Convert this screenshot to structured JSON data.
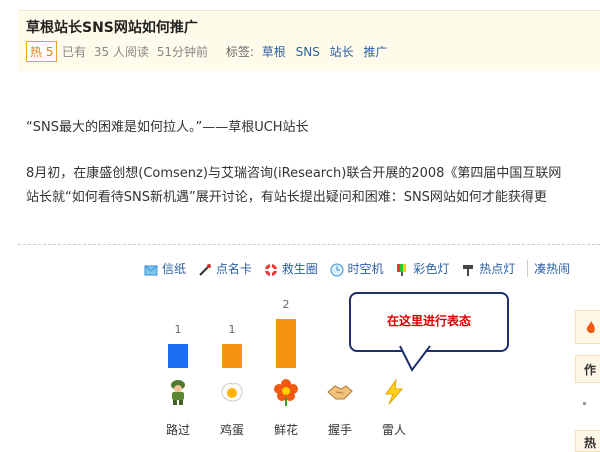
{
  "header": {
    "title": "草根站长SNS网站如何推广",
    "hot_badge": "热 5",
    "meta": {
      "already": "已有",
      "views": "35 人阅读",
      "time": "51分钟前",
      "tags_label": "标签:"
    },
    "tags": [
      "草根",
      "SNS",
      "站长",
      "推广"
    ]
  },
  "article": {
    "quote": "“SNS最大的困难是如何拉人。”——草根UCH站长",
    "line1": "8月初，在康盛创想(Comsenz)与艾瑞咨询(iResearch)联合开展的2008《第四届中国互联网",
    "line2": "站长就“如何看待SNS新机遇”展开讨论，有站长提出疑问和困难：SNS网站如何才能获得更"
  },
  "toolbar": {
    "items": [
      {
        "label": "信纸",
        "icon": "letter-icon"
      },
      {
        "label": "点名卡",
        "icon": "card-icon"
      },
      {
        "label": "救生圈",
        "icon": "lifebuoy-icon"
      },
      {
        "label": "时空机",
        "icon": "clock-icon"
      },
      {
        "label": "彩色灯",
        "icon": "color-lamp-icon"
      },
      {
        "label": "热点灯",
        "icon": "spotlight-icon"
      },
      {
        "label": "凑热闹",
        "icon": "crowd-icon"
      }
    ]
  },
  "reactions": {
    "bubble_text": "在这里进行表态",
    "items": [
      {
        "label": "路过",
        "count": "1",
        "color": "#1a6ff0",
        "icon": "soldier-icon"
      },
      {
        "label": "鸡蛋",
        "count": "1",
        "color": "#f6930f",
        "icon": "egg-icon"
      },
      {
        "label": "鲜花",
        "count": "2",
        "color": "#f6930f",
        "icon": "flower-icon"
      },
      {
        "label": "握手",
        "count": "",
        "color": "#f6930f",
        "icon": "handshake-icon"
      },
      {
        "label": "雷人",
        "count": "",
        "color": "#f6930f",
        "icon": "lightning-icon"
      }
    ]
  },
  "sidebar": {
    "label1": "作",
    "label2": "热"
  }
}
